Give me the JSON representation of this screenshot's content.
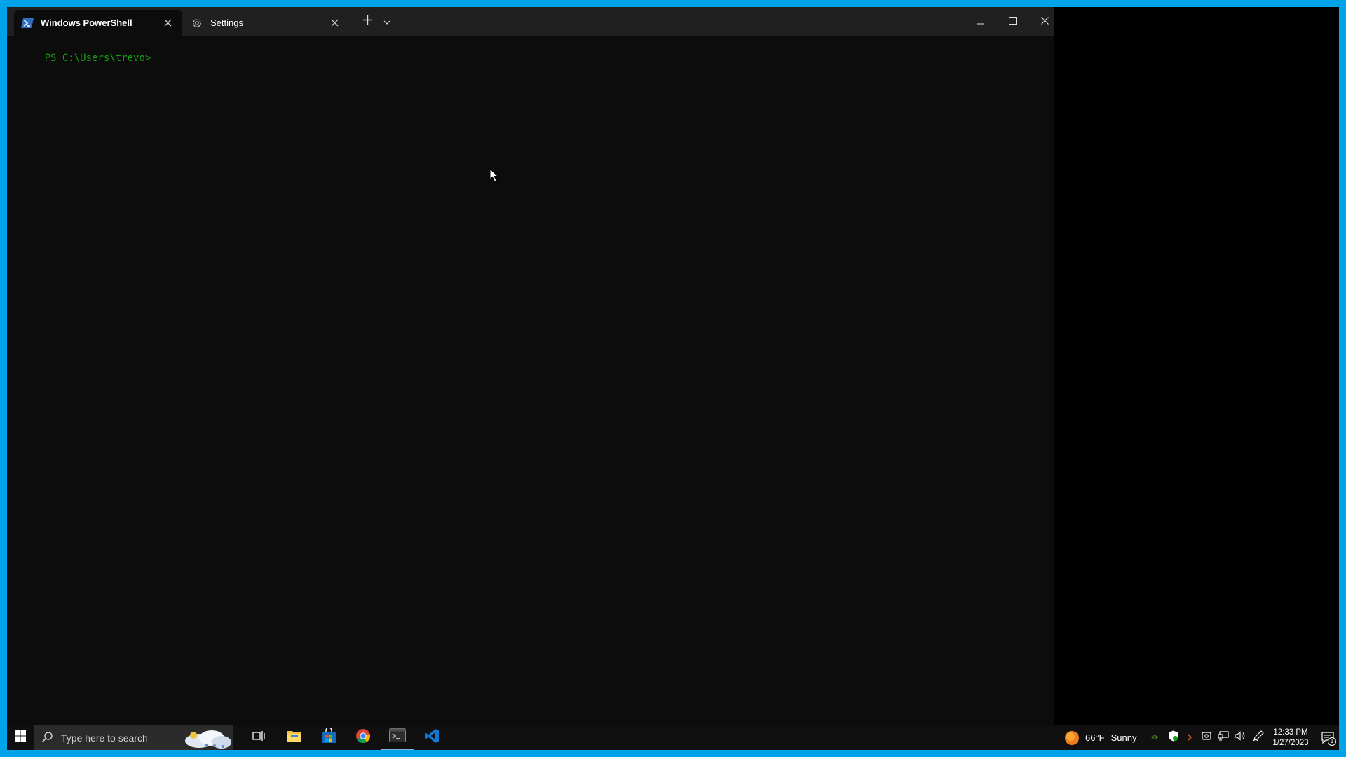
{
  "terminal": {
    "tabs": [
      {
        "label": "Windows PowerShell",
        "icon": "powershell-icon",
        "active": true
      },
      {
        "label": "Settings",
        "icon": "gear-icon",
        "active": false
      }
    ],
    "new_tab_icon": "plus-icon",
    "dropdown_icon": "chevron-down-icon",
    "prompt": "PS C:\\Users\\trevo>",
    "prompt_color": "#13a10e"
  },
  "taskbar": {
    "search_placeholder": "Type here to search",
    "pinned_apps": [
      "file-explorer-icon",
      "microsoft-store-icon",
      "chrome-icon",
      "terminal-icon",
      "vscode-icon"
    ],
    "weather": {
      "temperature": "66°F",
      "condition": "Sunny"
    },
    "clock": {
      "time": "12:33 PM",
      "date": "1/27/2023"
    },
    "notification_count": "1"
  },
  "colors": {
    "desktop_border": "#00a2e8",
    "titlebar": "#202020",
    "terminal_bg": "#0c0c0c",
    "taskbar": "#101010"
  }
}
